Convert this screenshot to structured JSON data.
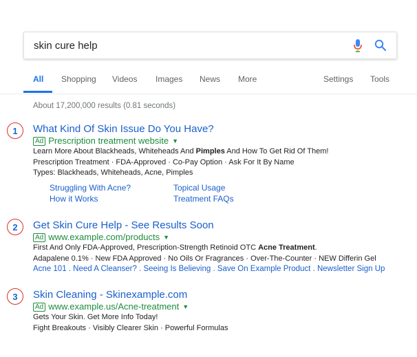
{
  "search": {
    "query": "skin cure help"
  },
  "tabs": [
    {
      "label": "All"
    },
    {
      "label": "Shopping"
    },
    {
      "label": "Videos"
    },
    {
      "label": "Images"
    },
    {
      "label": "News"
    },
    {
      "label": "More"
    },
    {
      "label": "Settings"
    },
    {
      "label": "Tools"
    }
  ],
  "stats": "About 17,200,000 results (0.81 seconds)",
  "ads": [
    {
      "number": "1",
      "title": "What Kind Of Skin Issue Do You Have?",
      "badge": "Ad",
      "url": "Prescription treatment website",
      "desc1_a": "Learn More About Blackheads, Whiteheads And ",
      "desc1_b": "Pimples",
      "desc1_c": " And How To Get Rid Of Them!",
      "desc2": "Prescription Treatment · FDA-Approved · Co-Pay Option · Ask For It By Name",
      "desc3": "Types: Blackheads, Whiteheads, Acne, Pimples",
      "sitelinks": [
        "Struggling With Acne?",
        "Topical Usage",
        "How it Works",
        "Treatment FAQs"
      ]
    },
    {
      "number": "2",
      "title": "Get Skin Cure Help - See Results Soon",
      "badge": "Ad",
      "url": "www.example.com/products",
      "desc1_a": "First And Only FDA-Approved, Prescription-Strength Retinoid OTC ",
      "desc1_b": "Acne Treatment",
      "desc1_c": ".",
      "desc2": "Adapalene 0.1% · New FDA Approved · No Oils Or Fragrances · Over-The-Counter · NEW Differin Gel",
      "links": "Acne 101 . Need A Cleanser? . Seeing Is Believing . Save On Example Product . Newsletter Sign Up"
    },
    {
      "number": "3",
      "title": "Skin Cleaning - Skinexample.com",
      "badge": "Ad",
      "url": "www.example.us/Acne-treatment",
      "desc1": "Gets Your Skin. Get More Info Today!",
      "desc2": "Fight Breakouts · Visibly Clearer Skin · Powerful Formulas"
    }
  ],
  "colors": {
    "accent": "#1a73e8",
    "link": "#1a5fcc",
    "url": "#1e8c3d",
    "marker": "#d93025"
  }
}
